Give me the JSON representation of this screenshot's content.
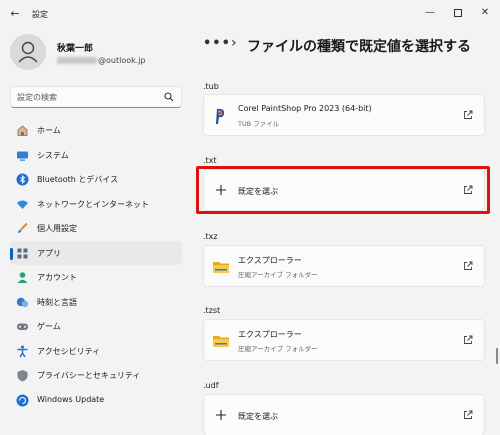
{
  "window": {
    "title": "設定",
    "back_glyph": "←",
    "minimize_glyph": "—",
    "close_glyph": "✕"
  },
  "profile": {
    "name": "秋葉一郎",
    "email_domain": "@outlook.jp"
  },
  "search": {
    "placeholder": "設定の検索"
  },
  "sidebar": {
    "items": [
      {
        "label": "ホーム",
        "icon": "home-icon"
      },
      {
        "label": "システム",
        "icon": "system-icon"
      },
      {
        "label": "Bluetooth とデバイス",
        "icon": "bluetooth-icon"
      },
      {
        "label": "ネットワークとインターネット",
        "icon": "network-icon"
      },
      {
        "label": "個人用設定",
        "icon": "brush-icon"
      },
      {
        "label": "アプリ",
        "icon": "apps-icon",
        "active": true
      },
      {
        "label": "アカウント",
        "icon": "account-icon"
      },
      {
        "label": "時刻と言語",
        "icon": "time-language-icon"
      },
      {
        "label": "ゲーム",
        "icon": "gaming-icon"
      },
      {
        "label": "アクセシビリティ",
        "icon": "accessibility-icon"
      },
      {
        "label": "プライバシーとセキュリティ",
        "icon": "shield-icon"
      },
      {
        "label": "Windows Update",
        "icon": "windows-update-icon"
      }
    ]
  },
  "breadcrumb": {
    "dots": "•••",
    "separator": "›",
    "title": "ファイルの種類で既定値を選択する"
  },
  "sections": [
    {
      "ext": ".tub",
      "app": "Corel PaintShop Pro 2023 (64-bit)",
      "sub": "TUB ファイル",
      "icon": "paintshop-icon"
    },
    {
      "ext": ".txt",
      "app": "既定を選ぶ",
      "icon": "plus-icon",
      "highlighted": true
    },
    {
      "ext": ".txz",
      "app": "エクスプローラー",
      "sub": "圧縮アーカイブ フォルダー",
      "icon": "folder-icon"
    },
    {
      "ext": ".tzst",
      "app": "エクスプローラー",
      "sub": "圧縮アーカイブ フォルダー",
      "icon": "folder-icon"
    },
    {
      "ext": ".udf",
      "app": "既定を選ぶ",
      "icon": "plus-icon"
    }
  ],
  "colors": {
    "accent": "#0067c0",
    "highlight": "#e01010",
    "background": "#f3f3f3"
  }
}
